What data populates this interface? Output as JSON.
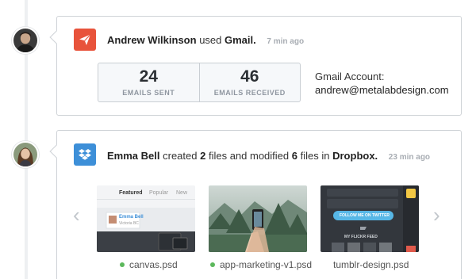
{
  "feed": [
    {
      "user": "Andrew Wilkinson",
      "action": "used",
      "service": "Gmail.",
      "time": "7 min ago",
      "stats": [
        {
          "value": "24",
          "label": "EMAILS SENT"
        },
        {
          "value": "46",
          "label": "EMAILS RECEIVED"
        }
      ],
      "account_label": "Gmail Account:",
      "account_email": "andrew@metalabdesign.com"
    },
    {
      "user": "Emma Bell",
      "action": "created",
      "created_count": "2",
      "middle": "files and modified",
      "modified_count": "6",
      "tail": "files in",
      "service": "Dropbox.",
      "time": "23 min ago",
      "files": [
        {
          "name": "canvas.psd",
          "preview": {
            "tabs": [
              "Featured",
              "Popular",
              "New"
            ],
            "profile_name": "Emma Bell",
            "profile_location": "Victoria BC"
          }
        },
        {
          "name": "app-marketing-v1.psd"
        },
        {
          "name": "tumblr-design.psd",
          "preview": {
            "twitter_button": "FOLLOW ME ON TWITTER",
            "feed_label": "MY FLICKR FEED"
          }
        }
      ]
    }
  ],
  "colors": {
    "gmail_icon": "#e8533b",
    "dropbox_icon": "#3d8fd8",
    "status_dot": "#5cb85c"
  },
  "icons": {
    "gmail": "paper-plane-icon",
    "dropbox": "dropbox-icon",
    "prev": "chevron-left-icon",
    "next": "chevron-right-icon"
  }
}
